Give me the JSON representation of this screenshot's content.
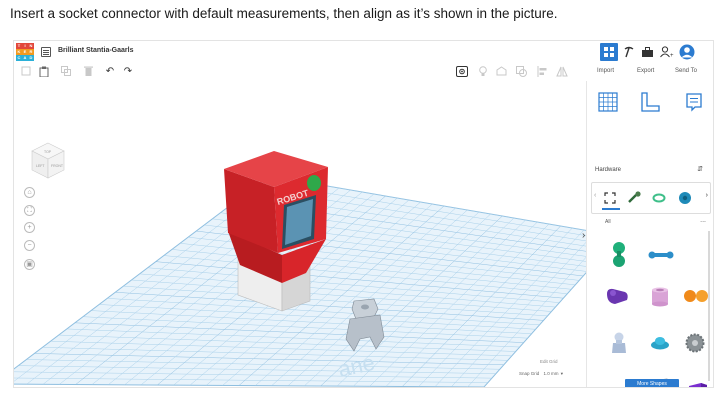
{
  "instruction": "Insert a socket connector with default measurements, then align as it’s shown in the picture.",
  "app": {
    "logo_letters": [
      "T",
      "I",
      "N",
      "K",
      "E",
      "R",
      "C",
      "A",
      "D"
    ],
    "logo_colors": [
      "#e2473b",
      "#e2473b",
      "#e2473b",
      "#f29a1f",
      "#f29a1f",
      "#f29a1f",
      "#2bb0d8",
      "#2bb0d8",
      "#2bb0d8"
    ],
    "design_title": "Brilliant Stantia-Gaarls"
  },
  "toolbar": {
    "import_label": "Import",
    "export_label": "Export",
    "sendto_label": "Send To"
  },
  "viewcube": {
    "top_label": "TOP",
    "front_label": "FRONT",
    "left_label": "LEFT"
  },
  "panel": {
    "category": "Hardware",
    "filter_label": "All",
    "more_label": "More Shapes",
    "more_dots": "..."
  },
  "grid": {
    "edit_grid_label": "Edit Grid",
    "snap_grid_label": "Snap Grid",
    "snap_value": "1.0 mm",
    "workplane_watermark": "ane"
  },
  "model": {
    "body_text": "ROBOT",
    "body_color": "#cc2024",
    "screen_color": "#4f87a6",
    "button_color": "#2fa84a",
    "base_color": "#dedede",
    "connector_color": "#b9c2cc"
  },
  "colors": {
    "accent": "#2b7bd0",
    "grid_bg": "#eaf4fb",
    "grid_line": "#9cc6e2"
  }
}
